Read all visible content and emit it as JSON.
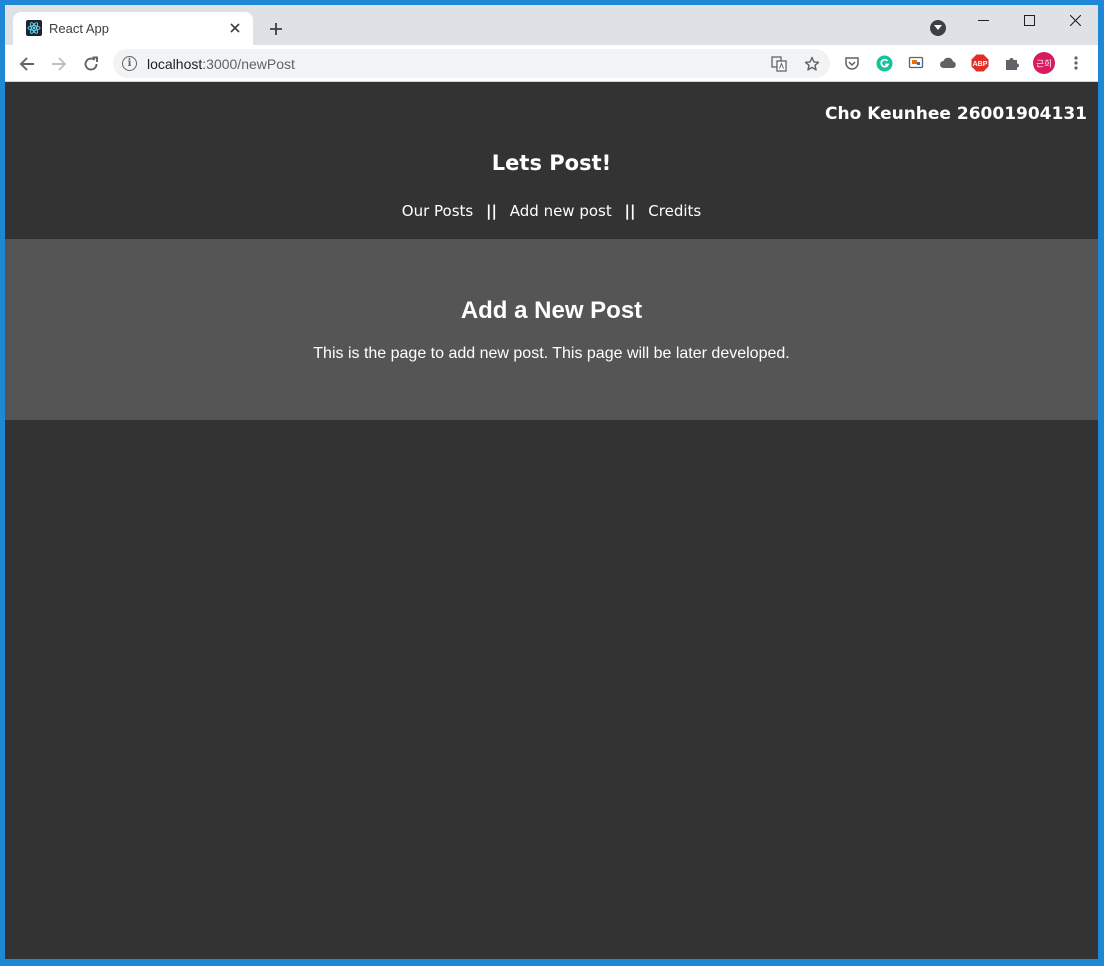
{
  "browser": {
    "tab_title": "React App",
    "url_host": "localhost",
    "url_path": ":3000/newPost",
    "extensions": [
      "pocket-icon",
      "grammarly-icon",
      "cast-icon",
      "cloud-icon",
      "adblock-plus-icon",
      "puzzle-extensions-icon"
    ],
    "adblock_label": "ABP",
    "profile_label": "근희",
    "profile_color": "#d81b60",
    "grammarly_color": "#15c39a"
  },
  "header": {
    "author": "Cho Keunhee 26001904131",
    "site_title": "Lets Post!",
    "nav": {
      "our_posts": "Our Posts",
      "separator": "||",
      "add_new_post": "Add new post",
      "credits": "Credits"
    }
  },
  "main": {
    "heading": "Add a New Post",
    "description": "This is the page to add new post. This page will be later developed."
  },
  "colors": {
    "page_bg": "#333333",
    "content_bg": "#555555",
    "text": "#ffffff"
  }
}
